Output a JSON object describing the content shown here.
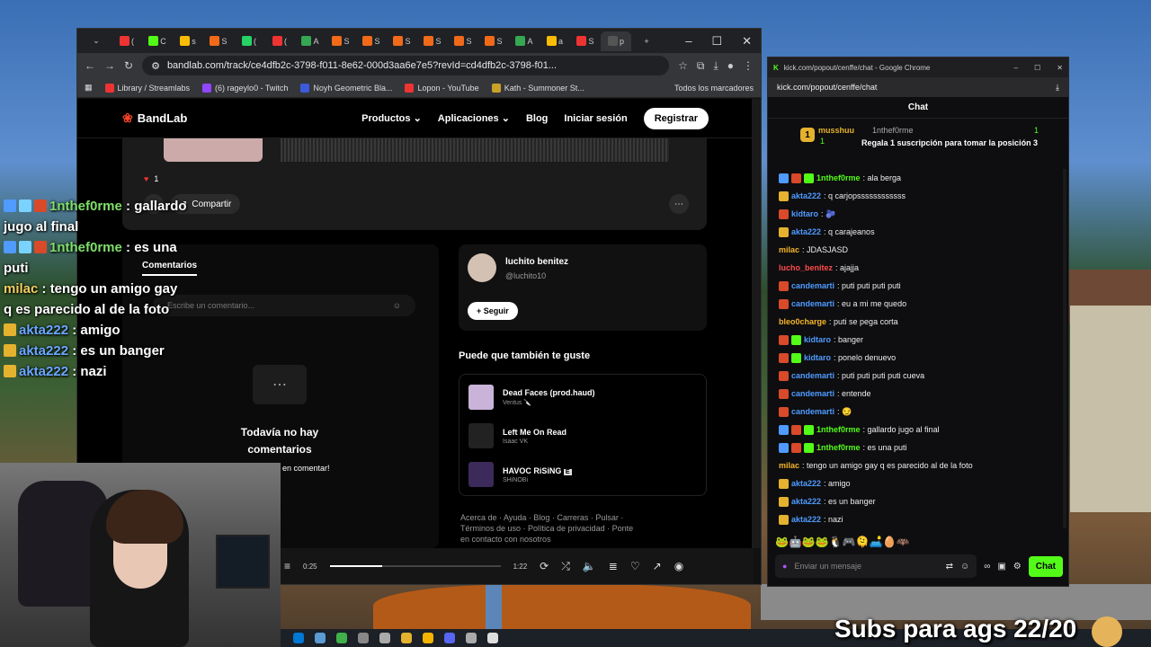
{
  "overlay_chat": [
    {
      "badges": [
        "#4f9bff",
        "#7ad3ff",
        "#d84a2a"
      ],
      "user": "1nthef0rme",
      "color": "green",
      "text": " : gallardo jugo al final"
    },
    {
      "badges": [
        "#4f9bff",
        "#7ad3ff",
        "#d84a2a"
      ],
      "user": "1nthef0rme",
      "color": "green",
      "text": " : es una puti"
    },
    {
      "badges": [],
      "user": "milac",
      "color": "yellow",
      "text": " : tengo un amigo gay q es parecido al de la foto"
    },
    {
      "badges": [
        "#e4b22e"
      ],
      "user": "akta222",
      "color": "blue",
      "text": " : amigo"
    },
    {
      "badges": [
        "#e4b22e"
      ],
      "user": "akta222",
      "color": "blue",
      "text": " : es un banger"
    },
    {
      "badges": [
        "#e4b22e"
      ],
      "user": "akta222",
      "color": "blue",
      "text": " : nazi"
    }
  ],
  "browser": {
    "url": "bandlab.com/track/ce4dfb2c-3798-f011-8e62-000d3aa6e7e5?revId=cd4dfb2c-3798-f01...",
    "tabs": [
      {
        "label": "(",
        "color": "#e33"
      },
      {
        "label": "C",
        "color": "#53fc18"
      },
      {
        "label": "s",
        "color": "#fbbc04"
      },
      {
        "label": "S",
        "color": "#f06a1a"
      },
      {
        "label": "(",
        "color": "#25d366"
      },
      {
        "label": "(",
        "color": "#e33"
      },
      {
        "label": "A",
        "color": "#34a853"
      },
      {
        "label": "S",
        "color": "#f06a1a"
      },
      {
        "label": "S",
        "color": "#f06a1a"
      },
      {
        "label": "S",
        "color": "#f06a1a"
      },
      {
        "label": "S",
        "color": "#f06a1a"
      },
      {
        "label": "S",
        "color": "#f06a1a"
      },
      {
        "label": "S",
        "color": "#f06a1a"
      },
      {
        "label": "A",
        "color": "#34a853"
      },
      {
        "label": "a",
        "color": "#fbbc04"
      },
      {
        "label": "S",
        "color": "#e33"
      },
      {
        "label": "p",
        "color": "#555"
      }
    ],
    "bookmarks": [
      {
        "label": "Library / Streamlabs",
        "color": "#e33"
      },
      {
        "label": "(6) rageylo0 - Twitch",
        "color": "#9146ff"
      },
      {
        "label": "Noyh Geometric Bla...",
        "color": "#3b5bdb"
      },
      {
        "label": "Lopon - YouTube",
        "color": "#e33"
      },
      {
        "label": "Kath - Summoner St...",
        "color": "#c9a227"
      }
    ],
    "all_bookmarks": "Todos los marcadores"
  },
  "bandlab": {
    "logo": "BandLab",
    "nav": [
      "Productos ⌄",
      "Aplicaciones ⌄",
      "Blog",
      "Iniciar sesión"
    ],
    "register": "Registrar",
    "likes": "1",
    "share": "Compartir",
    "comments_tab": "Comentarios",
    "comment_placeholder": "Escribe un comentario...",
    "empty_title": "Todavía no hay comentarios",
    "empty_sub": "en comentar!",
    "artist_name": "luchito benitez",
    "artist_handle": "@luchito10",
    "follow": "Seguir",
    "rec_title": "Puede que también te guste",
    "recommendations": [
      {
        "name": "Dead Faces (prod.haud)",
        "artist": "Ventus 🔪",
        "cover": "#c9b3d8"
      },
      {
        "name": "Left Me On Read",
        "artist": "Isaac VK",
        "cover": "#222"
      },
      {
        "name": "HAVOC RiSiNG",
        "artist": "SHiNOBi",
        "cover": "#3b2a5a",
        "explicit": "E"
      }
    ],
    "footer": "Acerca de · Ayuda · Blog · Carreras · Pulsar · Términos de uso · Política de privacidad · Ponte en contacto con nosotros",
    "time_current": "0:25",
    "time_total": "1:22",
    "progress": 0.305
  },
  "kick": {
    "window_title": "kick.com/popout/cenffe/chat - Google Chrome",
    "url": "kick.com/popout/cenffe/chat",
    "header": "Chat",
    "pinned": {
      "user1": "musshuu",
      "count1": "1",
      "user2": "1nthef0rme",
      "count2": "1",
      "text": "Regala 1 suscripción para tomar la posición 3"
    },
    "messages": [
      {
        "badges": [
          "#4f9bff",
          "#d84a2a",
          "#53fc18"
        ],
        "user": "1nthef0rme",
        "color": "green",
        "text": ": ala berga"
      },
      {
        "badges": [
          "#e4b22e"
        ],
        "user": "akta222",
        "color": "blue",
        "text": ": q carjopssssssssssss"
      },
      {
        "badges": [
          "#d84a2a"
        ],
        "user": "kidtaro",
        "color": "blue",
        "text": ": 🫐"
      },
      {
        "badges": [
          "#e4b22e"
        ],
        "user": "akta222",
        "color": "blue",
        "text": ": q carajeanos"
      },
      {
        "badges": [],
        "user": "milac",
        "color": "yellow",
        "text": ": JDASJASD"
      },
      {
        "badges": [],
        "user": "lucho_benitez",
        "color": "red",
        "text": ": ajajja"
      },
      {
        "badges": [
          "#d84a2a"
        ],
        "user": "candemarti",
        "color": "blue",
        "text": ": puti puti puti puti"
      },
      {
        "badges": [
          "#d84a2a"
        ],
        "user": "candemarti",
        "color": "blue",
        "text": ": eu a mi me quedo"
      },
      {
        "badges": [],
        "user": "bleo0charge",
        "color": "yellow",
        "text": ": puti se pega corta"
      },
      {
        "badges": [
          "#d84a2a",
          "#53fc18"
        ],
        "user": "kidtaro",
        "color": "blue",
        "text": ": banger"
      },
      {
        "badges": [
          "#d84a2a",
          "#53fc18"
        ],
        "user": "kidtaro",
        "color": "blue",
        "text": ": ponelo denuevo"
      },
      {
        "badges": [
          "#d84a2a"
        ],
        "user": "candemarti",
        "color": "blue",
        "text": ": puti puti puti puti cueva"
      },
      {
        "badges": [
          "#d84a2a"
        ],
        "user": "candemarti",
        "color": "blue",
        "text": ": entende"
      },
      {
        "badges": [
          "#d84a2a"
        ],
        "user": "candemarti",
        "color": "blue",
        "text": ": 😏"
      },
      {
        "badges": [
          "#4f9bff",
          "#d84a2a",
          "#53fc18"
        ],
        "user": "1nthef0rme",
        "color": "green",
        "text": ": gallardo jugo al final"
      },
      {
        "badges": [
          "#4f9bff",
          "#d84a2a",
          "#53fc18"
        ],
        "user": "1nthef0rme",
        "color": "green",
        "text": ": es una puti"
      },
      {
        "badges": [],
        "user": "milac",
        "color": "yellow",
        "text": ": tengo un amigo gay q es parecido al de la foto"
      },
      {
        "badges": [
          "#e4b22e"
        ],
        "user": "akta222",
        "color": "blue",
        "text": ": amigo"
      },
      {
        "badges": [
          "#e4b22e"
        ],
        "user": "akta222",
        "color": "blue",
        "text": ": es un banger"
      },
      {
        "badges": [
          "#e4b22e"
        ],
        "user": "akta222",
        "color": "blue",
        "text": ": nazi"
      }
    ],
    "emotes": "🐸🤖🐸🐸🐧🎮🫠🛋️🥚🦇",
    "input_placeholder": "Enviar un mensaje",
    "chat_button": "Chat"
  },
  "stream_overlay": {
    "subs_text": "Subs para ags 22/20"
  },
  "taskbar_icons": [
    "#0078d4",
    "#5b9bd5",
    "#3fb04a",
    "#888",
    "#aaa",
    "#e4b22e",
    "#f4b400",
    "#5865f2",
    "#aaa",
    "#ddd"
  ]
}
